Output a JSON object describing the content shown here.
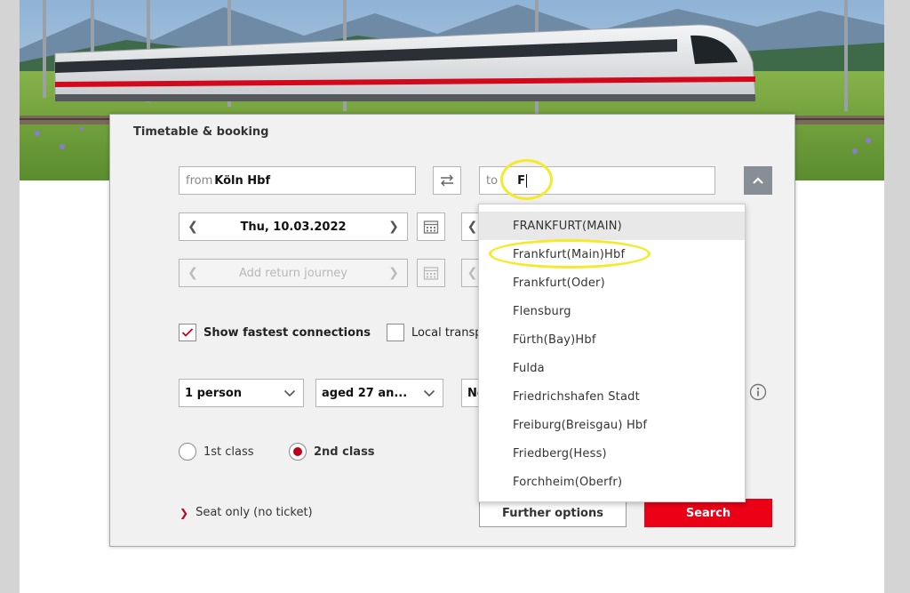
{
  "colors": {
    "accent_red": "#ec0016",
    "radio_red": "#c0001a",
    "annotation_yellow": "#f4ea2a",
    "panel_bg": "#f1f1f1",
    "dark_button": "#878e96"
  },
  "booking": {
    "title": "Timetable & booking",
    "from_prefix": "from",
    "from_value": "Köln Hbf",
    "to_prefix": "to",
    "to_value": "F",
    "swap_icon": "swap-arrows-icon",
    "collapse_icon": "chevron-up-icon",
    "outbound_date": "Thu, 10.03.2022",
    "return_placeholder": "Add return journey",
    "calendar_icon": "calendar-icon",
    "fastest_label": "Show fastest connections",
    "fastest_checked": true,
    "local_label": "Local transp",
    "local_checked": false,
    "persons": "1 person",
    "age": "aged 27 an...",
    "bahncard_partial": "Ne",
    "info_icon": "info-icon",
    "class_first": "1st class",
    "class_second": "2nd class",
    "selected_class": "2nd class",
    "seat_only_link": "Seat only (no ticket)",
    "further_options": "Further options",
    "search": "Search"
  },
  "suggestions": [
    "FRANKFURT(MAIN)",
    "Frankfurt(Main)Hbf",
    "Frankfurt(Oder)",
    "Flensburg",
    "Fürth(Bay)Hbf",
    "Fulda",
    "Friedrichshafen Stadt",
    "Freiburg(Breisgau) Hbf",
    "Friedberg(Hess)",
    "Forchheim(Oberfr)"
  ]
}
